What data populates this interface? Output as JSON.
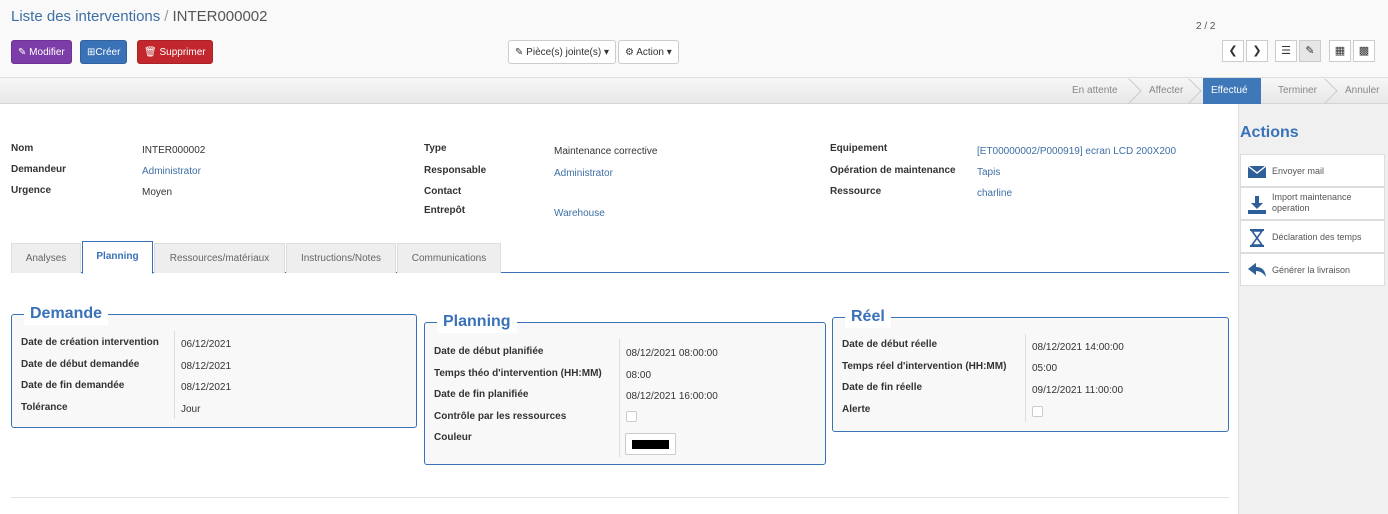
{
  "breadcrumb": {
    "parent": "Liste des interventions",
    "separator": "/",
    "current": "INTER000002"
  },
  "toolbar": {
    "edit_label": "Modifier",
    "create_label": "Créer",
    "delete_label": "Supprimer",
    "attachments_label": "Pièce(s) jointe(s)",
    "action_label": "Action"
  },
  "pager": {
    "value": "2 / 2"
  },
  "statusbar": {
    "stages": [
      "En attente",
      "Affecter",
      "Effectué",
      "Terminer",
      "Annuler"
    ],
    "active": "Effectué"
  },
  "fields": {
    "col1": [
      {
        "label": "Nom",
        "value": "INTER000002",
        "link": false
      },
      {
        "label": "Demandeur",
        "value": "Administrator",
        "link": true
      },
      {
        "label": "Urgence",
        "value": "Moyen",
        "link": false
      }
    ],
    "col2": [
      {
        "label": "Type",
        "value": "Maintenance corrective",
        "link": false
      },
      {
        "label": "Responsable",
        "value": "Administrator",
        "link": true
      },
      {
        "label": "Contact",
        "value": "",
        "link": false
      },
      {
        "label": "Entrepôt",
        "value": "Warehouse",
        "link": true
      }
    ],
    "col3": [
      {
        "label": "Equipement",
        "value": "[ET00000002/P000919] ecran LCD 200X200",
        "link": true
      },
      {
        "label": "Opération de maintenance",
        "value": "Tapis",
        "link": true
      },
      {
        "label": "Ressource",
        "value": "charline",
        "link": true
      }
    ]
  },
  "tabs": [
    "Analyses",
    "Planning",
    "Ressources/matériaux",
    "Instructions/Notes",
    "Communications"
  ],
  "active_tab": "Planning",
  "demande": {
    "title": "Demande",
    "rows": [
      {
        "label": "Date de création intervention",
        "value": "06/12/2021"
      },
      {
        "label": "Date de début demandée",
        "value": "08/12/2021"
      },
      {
        "label": "Date de fin demandée",
        "value": "08/12/2021"
      },
      {
        "label": "Tolérance",
        "value": "Jour"
      }
    ]
  },
  "planning": {
    "title": "Planning",
    "rows": [
      {
        "label": "Date de début planifiée",
        "value": "08/12/2021 08:00:00"
      },
      {
        "label": "Temps théo d'intervention (HH:MM)",
        "value": "08:00"
      },
      {
        "label": "Date de fin planifiée",
        "value": "08/12/2021 16:00:00"
      },
      {
        "label": "Contrôle par les ressources",
        "value": ""
      },
      {
        "label": "Couleur",
        "value": ""
      }
    ],
    "color": "#000000"
  },
  "reel": {
    "title": "Réel",
    "rows": [
      {
        "label": "Date de début réelle",
        "value": "08/12/2021 14:00:00"
      },
      {
        "label": "Temps réel d'intervention (HH:MM)",
        "value": "05:00"
      },
      {
        "label": "Date de fin réelle",
        "value": "09/12/2021 11:00:00"
      },
      {
        "label": "Alerte",
        "value": ""
      }
    ]
  },
  "actions": {
    "title": "Actions",
    "items": [
      {
        "label": "Envoyer mail",
        "icon": "envelope-icon"
      },
      {
        "label": "Import maintenance operation",
        "icon": "download-icon"
      },
      {
        "label": "Déclaration des temps",
        "icon": "hourglass-icon"
      },
      {
        "label": "Générer la livraison",
        "icon": "reply-arrow-icon"
      }
    ]
  },
  "colors": {
    "primary": "#3a72b8",
    "purple": "#7c3da8",
    "danger": "#c1272d"
  }
}
